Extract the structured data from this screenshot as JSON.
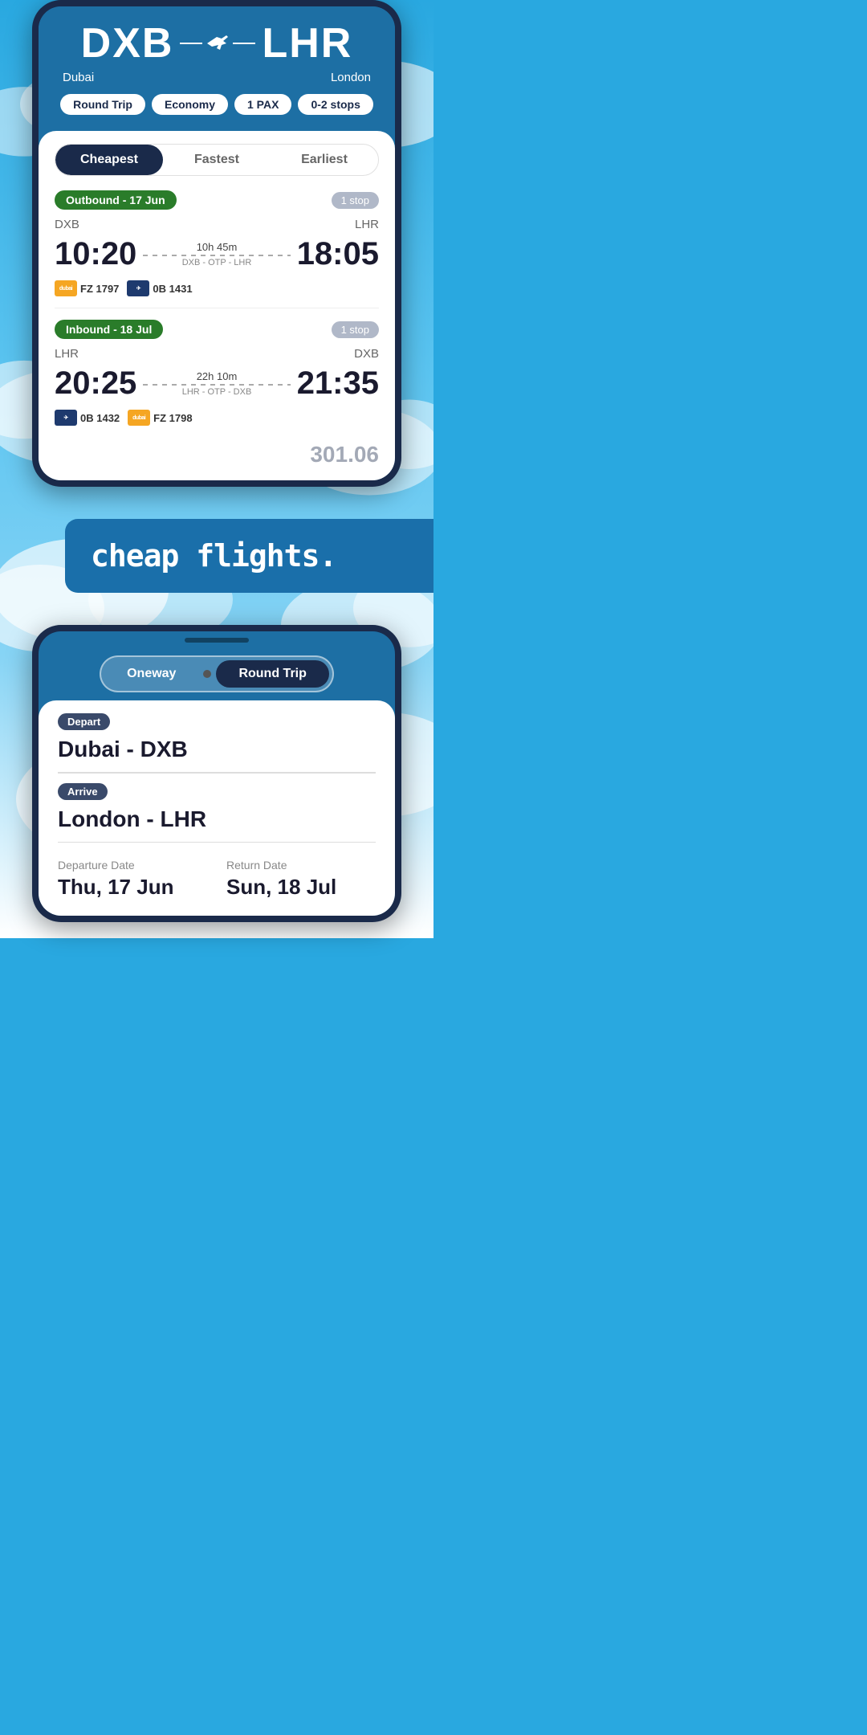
{
  "app": {
    "tagline": "cheap flights."
  },
  "phone1": {
    "origin_code": "DXB",
    "origin_city": "Dubai",
    "dest_code": "LHR",
    "dest_city": "London",
    "trip_type": "Round Trip",
    "cabin": "Economy",
    "passengers": "1 PAX",
    "stops": "0-2 stops",
    "tabs": [
      "Cheapest",
      "Fastest",
      "Earliest"
    ],
    "active_tab": "Cheapest",
    "outbound": {
      "label": "Outbound - 17 Jun",
      "stop_label": "1 stop",
      "origin": "DXB",
      "dest": "LHR",
      "depart_time": "10:20",
      "arrive_time": "18:05",
      "duration": "10h 45m",
      "via": "DXB - OTP - LHR",
      "flight1_logo": "FZ",
      "flight1_code": "FZ 1797",
      "flight2_logo": "0B",
      "flight2_code": "0B 1431"
    },
    "inbound": {
      "label": "Inbound - 18 Jul",
      "stop_label": "1 stop",
      "origin": "LHR",
      "dest": "DXB",
      "depart_time": "20:25",
      "arrive_time": "21:35",
      "duration": "22h 10m",
      "via": "LHR - OTP - DXB",
      "flight1_logo": "0B",
      "flight1_code": "0B 1432",
      "flight2_logo": "FZ",
      "flight2_code": "FZ 1798"
    },
    "price_preview": "301.06"
  },
  "phone2": {
    "toggle_options": [
      "Oneway",
      "Round Trip"
    ],
    "active_toggle": "Round Trip",
    "depart_label": "Depart",
    "depart_value": "Dubai - DXB",
    "arrive_label": "Arrive",
    "arrive_value": "London - LHR",
    "departure_date_label": "Departure Date",
    "departure_date_value": "Thu, 17 Jun",
    "return_date_label": "Return Date",
    "return_date_value": "Sun, 18 Jul"
  }
}
